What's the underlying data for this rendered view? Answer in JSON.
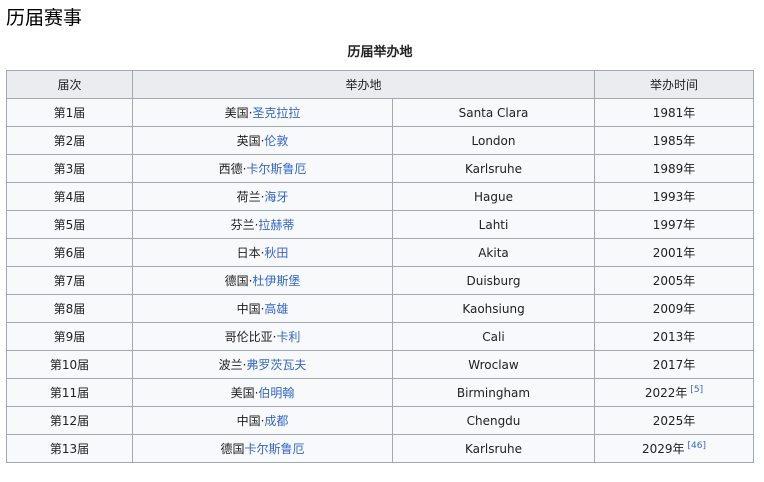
{
  "section_title": "历届赛事",
  "table": {
    "caption": "历届举办地",
    "headers": {
      "edition": "届次",
      "venue": "举办地",
      "year": "举办时间"
    },
    "rows": [
      {
        "edition": "第1届",
        "country": "美国",
        "sep": "·",
        "city": "圣克拉拉",
        "city_en": "Santa Clara",
        "year": "1981年",
        "ref": ""
      },
      {
        "edition": "第2届",
        "country": "英国",
        "sep": "·",
        "city": "伦敦",
        "city_en": "London",
        "year": "1985年",
        "ref": ""
      },
      {
        "edition": "第3届",
        "country": "西德",
        "sep": "·",
        "city": "卡尔斯鲁厄",
        "city_en": "Karlsruhe",
        "year": "1989年",
        "ref": ""
      },
      {
        "edition": "第4届",
        "country": "荷兰",
        "sep": "·",
        "city": "海牙",
        "city_en": "Hague",
        "year": "1993年",
        "ref": ""
      },
      {
        "edition": "第5届",
        "country": "芬兰",
        "sep": "·",
        "city": "拉赫蒂",
        "city_en": "Lahti",
        "year": "1997年",
        "ref": ""
      },
      {
        "edition": "第6届",
        "country": "日本",
        "sep": "·",
        "city": "秋田",
        "city_en": "Akita",
        "year": "2001年",
        "ref": ""
      },
      {
        "edition": "第7届",
        "country": "德国",
        "sep": "·",
        "city": "杜伊斯堡",
        "city_en": "Duisburg",
        "year": "2005年",
        "ref": ""
      },
      {
        "edition": "第8届",
        "country": "中国",
        "sep": "·",
        "city": "高雄",
        "city_en": "Kaohsiung",
        "year": "2009年",
        "ref": ""
      },
      {
        "edition": "第9届",
        "country": "哥伦比亚",
        "sep": "·",
        "city": "卡利",
        "city_en": "Cali",
        "year": "2013年",
        "ref": ""
      },
      {
        "edition": "第10届",
        "country": "波兰",
        "sep": "·",
        "city": "弗罗茨瓦夫",
        "city_en": "Wroclaw",
        "year": "2017年",
        "ref": ""
      },
      {
        "edition": "第11届",
        "country": "美国",
        "sep": "·",
        "city": "伯明翰",
        "city_en": "Birmingham",
        "year": "2022年",
        "ref": "[5]"
      },
      {
        "edition": "第12届",
        "country": "中国",
        "sep": "·",
        "city": "成都",
        "city_en": "Chengdu",
        "year": "2025年",
        "ref": ""
      },
      {
        "edition": "第13届",
        "country": "德国",
        "sep": "",
        "city": "卡尔斯鲁厄",
        "city_en": "Karlsruhe",
        "year": "2029年",
        "ref": "[46]"
      }
    ]
  }
}
